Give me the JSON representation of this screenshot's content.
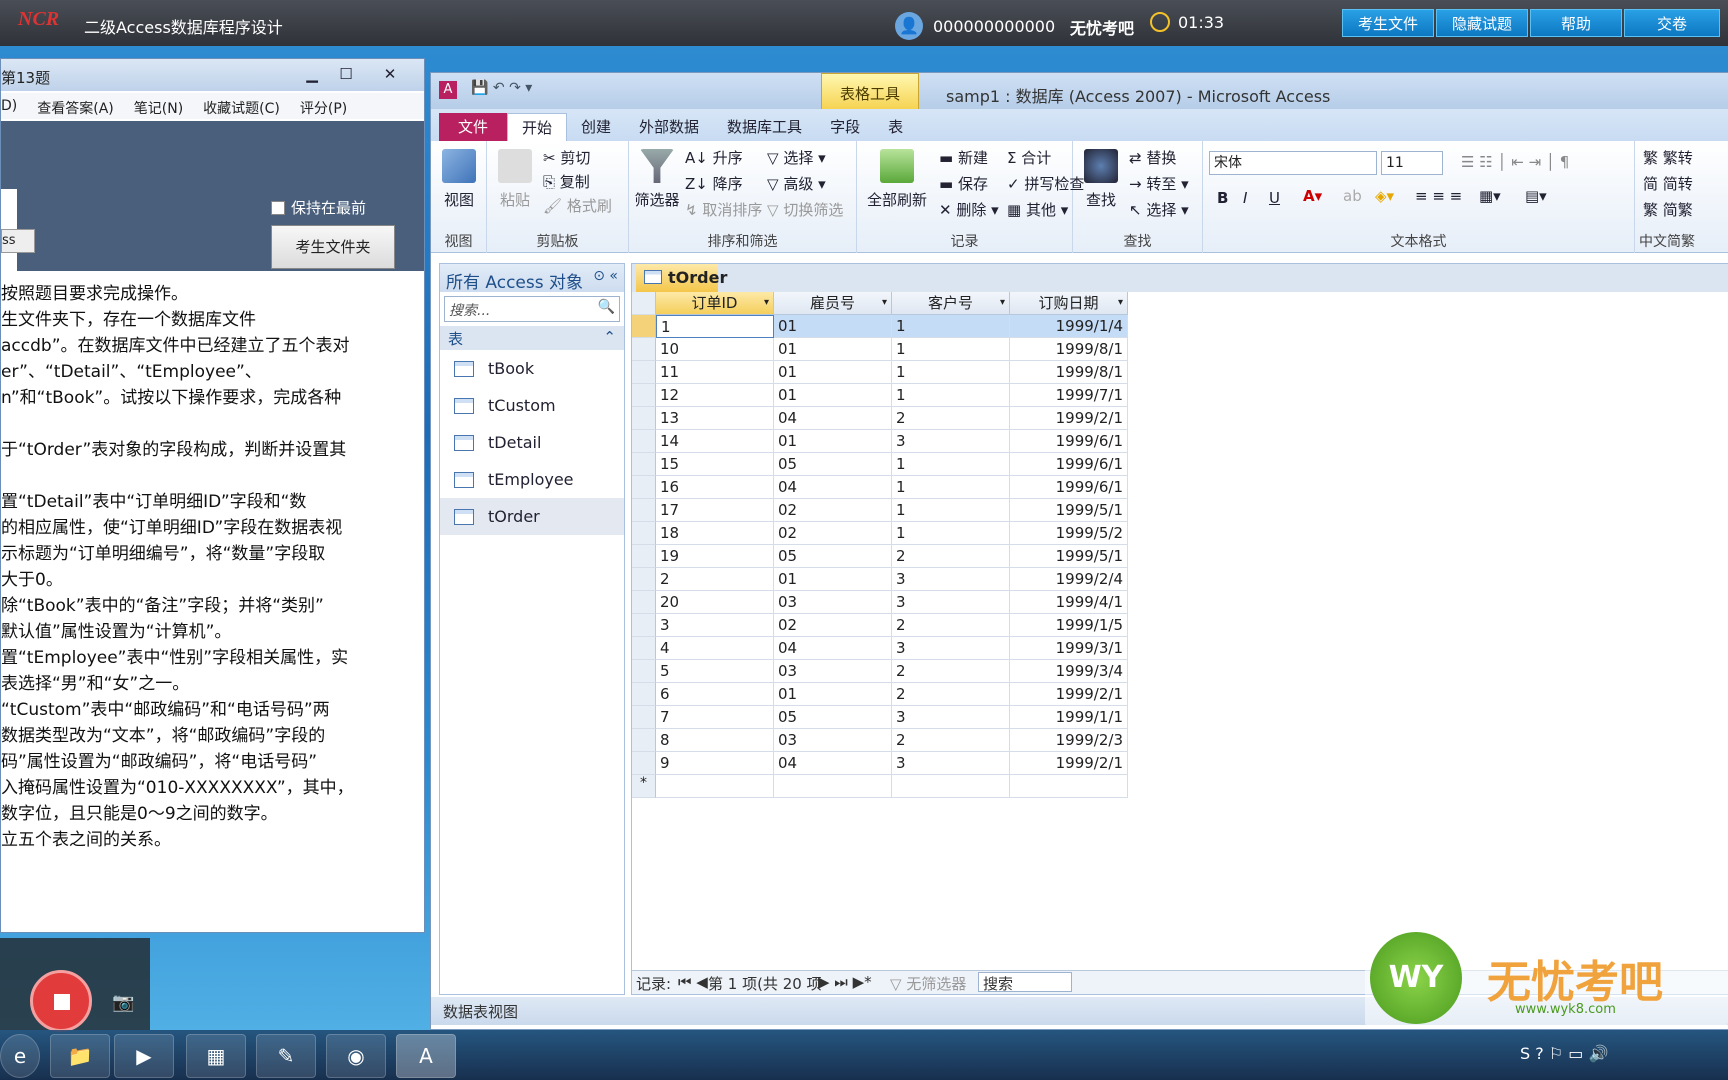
{
  "exam_bar": {
    "title": "二级Access数据库程序设计",
    "user_id": "000000000000",
    "brand": "无忧考吧",
    "timer": "01:33",
    "buttons": [
      "考生文件",
      "隐藏试题",
      "帮助",
      "交卷"
    ]
  },
  "left_window": {
    "title": "第13题",
    "menu": [
      "D)",
      "查看答案(A)",
      "笔记(N)",
      "收藏试题(C)",
      "评分(P)"
    ],
    "stay_on_top": "保持在最前",
    "folder_button": "考生文件夹",
    "mini_button": "ss",
    "question_lines": [
      "按照题目要求完成操作。",
      "生文件夹下，存在一个数据库文件",
      "accdb”。在数据库文件中已经建立了五个表对",
      "er”、“tDetail”、“tEmployee”、",
      "n”和“tBook”。试按以下操作要求，完成各种",
      "",
      "于“tOrder”表对象的字段构成，判断并设置其",
      "",
      "置“tDetail”表中“订单明细ID”字段和“数",
      "的相应属性，使“订单明细ID”字段在数据表视",
      "示标题为“订单明细编号”，将“数量”字段取",
      "大于0。",
      "除“tBook”表中的“备注”字段；并将“类别”",
      "默认值”属性设置为“计算机”。",
      "置“tEmployee”表中“性别”字段相关属性，实",
      "表选择“男”和“女”之一。",
      "“tCustom”表中“邮政编码”和“电话号码”两",
      "数据类型改为“文本”，将“邮政编码”字段的",
      "码”属性设置为“邮政编码”，将“电话号码”",
      "入掩码属性设置为“010-XXXXXXXX”，其中，",
      "数字位，且只能是0～9之间的数字。",
      "立五个表之间的关系。"
    ]
  },
  "access": {
    "title": "samp1 : 数据库 (Access 2007) - Microsoft Access",
    "table_tools": "表格工具",
    "tabs": [
      "文件",
      "开始",
      "创建",
      "外部数据",
      "数据库工具",
      "字段",
      "表"
    ],
    "ribbon": {
      "view": "视图",
      "paste": "粘贴",
      "cut": "剪切",
      "copy": "复制",
      "format_painter": "格式刷",
      "filter": "筛选器",
      "asc": "升序",
      "desc": "降序",
      "clear_sort": "取消排序",
      "select": "选择",
      "advanced": "高级",
      "toggle_filter": "切换筛选",
      "refresh_all": "全部刷新",
      "new": "新建",
      "save": "保存",
      "delete": "删除",
      "total": "合计",
      "spelling": "拼写检查",
      "more": "其他",
      "find": "查找",
      "replace": "替换",
      "goto": "转至",
      "select2": "选择",
      "font": "宋体",
      "size": "11",
      "bold": "B",
      "italic": "I",
      "underline": "U",
      "fan": "繁转",
      "jian": "简转",
      "jianfan": "简繁",
      "groups": [
        "视图",
        "剪贴板",
        "排序和筛选",
        "记录",
        "查找",
        "文本格式",
        "中文简繁"
      ]
    },
    "nav": {
      "header": "所有 Access 对象",
      "search_placeholder": "搜索...",
      "section": "表",
      "items": [
        "tBook",
        "tCustom",
        "tDetail",
        "tEmployee",
        "tOrder"
      ]
    },
    "sheet": {
      "tab": "tOrder",
      "columns": [
        "订单ID",
        "雇员号",
        "客户号",
        "订购日期"
      ],
      "rows": [
        [
          "1",
          "01",
          "1",
          "1999/1/4"
        ],
        [
          "10",
          "01",
          "1",
          "1999/8/1"
        ],
        [
          "11",
          "01",
          "1",
          "1999/8/1"
        ],
        [
          "12",
          "01",
          "1",
          "1999/7/1"
        ],
        [
          "13",
          "04",
          "2",
          "1999/2/1"
        ],
        [
          "14",
          "01",
          "3",
          "1999/6/1"
        ],
        [
          "15",
          "05",
          "1",
          "1999/6/1"
        ],
        [
          "16",
          "04",
          "1",
          "1999/6/1"
        ],
        [
          "17",
          "02",
          "1",
          "1999/5/1"
        ],
        [
          "18",
          "02",
          "1",
          "1999/5/2"
        ],
        [
          "19",
          "05",
          "2",
          "1999/5/1"
        ],
        [
          "2",
          "01",
          "3",
          "1999/2/4"
        ],
        [
          "20",
          "03",
          "3",
          "1999/4/1"
        ],
        [
          "3",
          "02",
          "2",
          "1999/1/5"
        ],
        [
          "4",
          "04",
          "3",
          "1999/3/1"
        ],
        [
          "5",
          "03",
          "2",
          "1999/3/4"
        ],
        [
          "6",
          "01",
          "2",
          "1999/2/1"
        ],
        [
          "7",
          "05",
          "3",
          "1999/1/1"
        ],
        [
          "8",
          "03",
          "2",
          "1999/2/3"
        ],
        [
          "9",
          "04",
          "3",
          "1999/2/1"
        ]
      ],
      "new_row_marker": "*"
    },
    "record_nav": {
      "label": "记录:",
      "position": "第 1 项(共 20 项",
      "no_filter": "无筛选器",
      "search": "搜索"
    },
    "status": "数据表视图"
  },
  "watermark": {
    "logo": "WY",
    "text": "无忧考吧",
    "url": "www.wyk8.com"
  },
  "colors": {
    "file_tab": "#b8205f",
    "exam_button": "#0c78c2",
    "rec": "#e23b3b"
  }
}
